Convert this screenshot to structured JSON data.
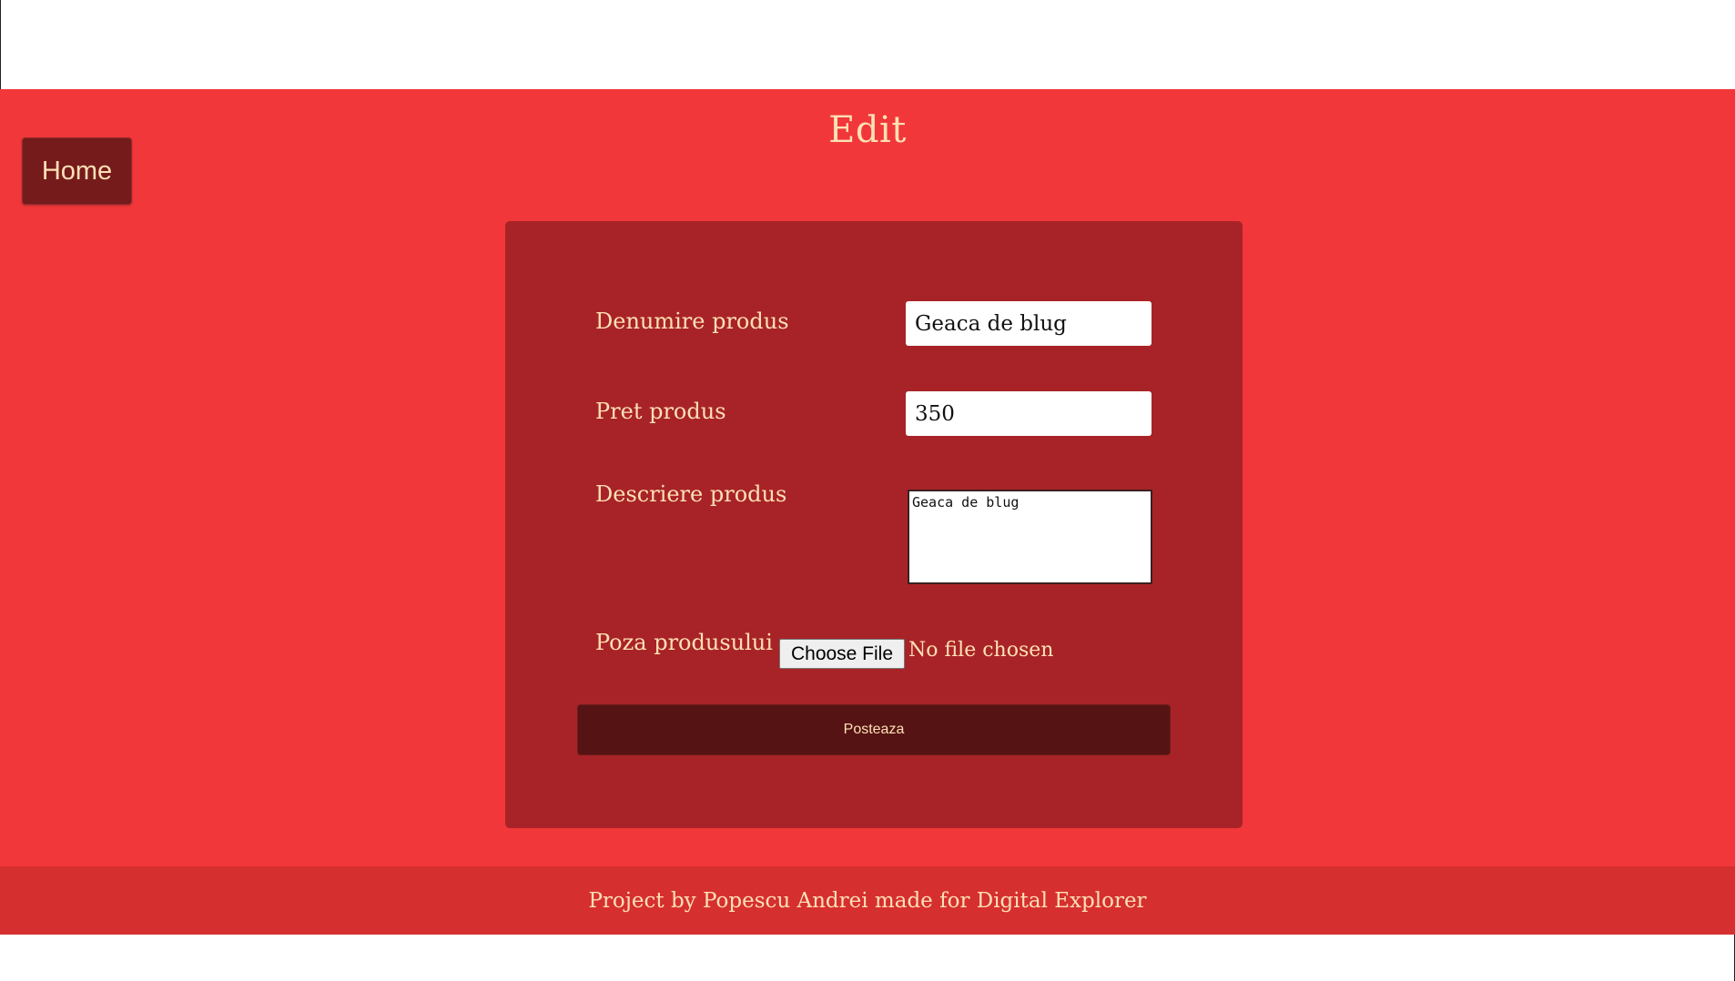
{
  "nav": {
    "home_label": "Home"
  },
  "page": {
    "title": "Edit"
  },
  "form": {
    "name_label": "Denumire produs",
    "name_value": "Geaca de blug",
    "price_label": "Pret produs",
    "price_value": "350",
    "description_label": "Descriere produs",
    "description_value": "Geaca de blug",
    "image_label": "Poza produsului",
    "file_button_label": "Choose File",
    "file_status": "No file chosen",
    "submit_label": "Posteaza"
  },
  "footer": {
    "text": "Project by Popescu Andrei made for Digital Explorer"
  },
  "colors": {
    "background": "#f1373a",
    "card": "#a82327",
    "home_button": "#761b1c",
    "submit_button": "#551314",
    "footer": "#d62f30",
    "text_accent": "#fde0b5"
  }
}
